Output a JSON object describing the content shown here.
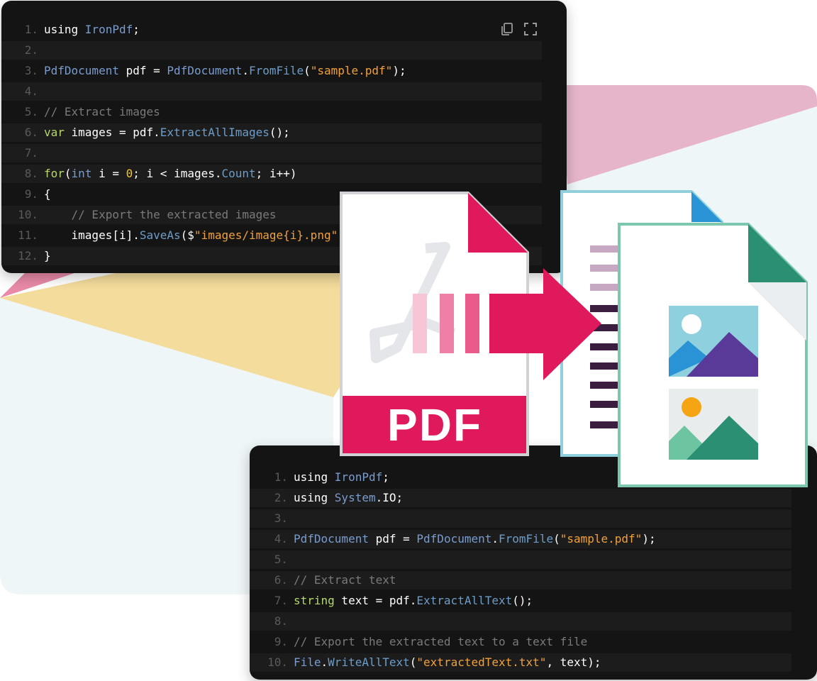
{
  "colors": {
    "panel_bg": "#141414",
    "pdf_accent": "#e0185c",
    "text_doc_accent": "#2a93d5",
    "image_doc_accent": "#2a8f73",
    "bg_pink": "#e7b8cc",
    "bg_yellow": "#f4dfa0",
    "bg_light": "#eef6f8"
  },
  "top_code": {
    "toolbar": {
      "copy_icon": "copy-icon",
      "fullscreen_icon": "fullscreen-icon"
    },
    "lines": [
      {
        "num": "1.",
        "tokens": [
          {
            "t": "using ",
            "c": "t-plain"
          },
          {
            "t": "IronPdf",
            "c": "t-type"
          },
          {
            "t": ";",
            "c": "t-plain"
          }
        ]
      },
      {
        "num": "2.",
        "tokens": []
      },
      {
        "num": "3.",
        "tokens": [
          {
            "t": "PdfDocument",
            "c": "t-type"
          },
          {
            "t": " pdf = ",
            "c": "t-plain"
          },
          {
            "t": "PdfDocument",
            "c": "t-type"
          },
          {
            "t": ".",
            "c": "t-plain"
          },
          {
            "t": "FromFile",
            "c": "t-method"
          },
          {
            "t": "(",
            "c": "t-plain"
          },
          {
            "t": "\"sample.pdf\"",
            "c": "t-str"
          },
          {
            "t": ");",
            "c": "t-plain"
          }
        ]
      },
      {
        "num": "4.",
        "tokens": []
      },
      {
        "num": "5.",
        "tokens": [
          {
            "t": "// Extract images",
            "c": "t-comment"
          }
        ]
      },
      {
        "num": "6.",
        "tokens": [
          {
            "t": "var",
            "c": "t-kw"
          },
          {
            "t": " images = pdf.",
            "c": "t-plain"
          },
          {
            "t": "ExtractAllImages",
            "c": "t-method"
          },
          {
            "t": "();",
            "c": "t-plain"
          }
        ]
      },
      {
        "num": "7.",
        "tokens": []
      },
      {
        "num": "8.",
        "tokens": [
          {
            "t": "for",
            "c": "t-kw"
          },
          {
            "t": "(",
            "c": "t-plain"
          },
          {
            "t": "int",
            "c": "t-type"
          },
          {
            "t": " i = ",
            "c": "t-plain"
          },
          {
            "t": "0",
            "c": "t-num"
          },
          {
            "t": "; i < images.",
            "c": "t-plain"
          },
          {
            "t": "Count",
            "c": "t-method"
          },
          {
            "t": "; i++)",
            "c": "t-plain"
          }
        ]
      },
      {
        "num": "9.",
        "tokens": [
          {
            "t": "{",
            "c": "t-plain"
          }
        ]
      },
      {
        "num": "10.",
        "tokens": [
          {
            "t": "    // Export the extracted images",
            "c": "t-comment"
          }
        ]
      },
      {
        "num": "11.",
        "tokens": [
          {
            "t": "    images[i].",
            "c": "t-plain"
          },
          {
            "t": "SaveAs",
            "c": "t-method"
          },
          {
            "t": "($",
            "c": "t-plain"
          },
          {
            "t": "\"images/image{i}.png\"",
            "c": "t-str"
          },
          {
            "t": ");",
            "c": "t-plain"
          }
        ]
      },
      {
        "num": "12.",
        "tokens": [
          {
            "t": "}",
            "c": "t-plain"
          }
        ]
      }
    ]
  },
  "bottom_code": {
    "lines": [
      {
        "num": "1.",
        "tokens": [
          {
            "t": "using ",
            "c": "t-plain"
          },
          {
            "t": "IronPdf",
            "c": "t-type"
          },
          {
            "t": ";",
            "c": "t-plain"
          }
        ]
      },
      {
        "num": "2.",
        "tokens": [
          {
            "t": "using ",
            "c": "t-plain"
          },
          {
            "t": "System",
            "c": "t-type"
          },
          {
            "t": ".IO;",
            "c": "t-plain"
          }
        ]
      },
      {
        "num": "3.",
        "tokens": []
      },
      {
        "num": "4.",
        "tokens": [
          {
            "t": "PdfDocument",
            "c": "t-type"
          },
          {
            "t": " pdf = ",
            "c": "t-plain"
          },
          {
            "t": "PdfDocument",
            "c": "t-type"
          },
          {
            "t": ".",
            "c": "t-plain"
          },
          {
            "t": "FromFile",
            "c": "t-method"
          },
          {
            "t": "(",
            "c": "t-plain"
          },
          {
            "t": "\"sample.pdf\"",
            "c": "t-str"
          },
          {
            "t": ");",
            "c": "t-plain"
          }
        ]
      },
      {
        "num": "5.",
        "tokens": []
      },
      {
        "num": "6.",
        "tokens": [
          {
            "t": "// Extract text",
            "c": "t-comment"
          }
        ]
      },
      {
        "num": "7.",
        "tokens": [
          {
            "t": "string",
            "c": "t-kw"
          },
          {
            "t": " text = pdf.",
            "c": "t-plain"
          },
          {
            "t": "ExtractAllText",
            "c": "t-method"
          },
          {
            "t": "();",
            "c": "t-plain"
          }
        ]
      },
      {
        "num": "8.",
        "tokens": []
      },
      {
        "num": "9.",
        "tokens": [
          {
            "t": "// Export the extracted text to a text file",
            "c": "t-comment"
          }
        ]
      },
      {
        "num": "10.",
        "tokens": [
          {
            "t": "File",
            "c": "t-type"
          },
          {
            "t": ".",
            "c": "t-plain"
          },
          {
            "t": "WriteAllText",
            "c": "t-method"
          },
          {
            "t": "(",
            "c": "t-plain"
          },
          {
            "t": "\"extractedText.txt\"",
            "c": "t-str"
          },
          {
            "t": ", text);",
            "c": "t-plain"
          }
        ]
      }
    ]
  },
  "illustration": {
    "pdf_label": "PDF",
    "pdf_icon": "acrobat-icon",
    "arrow_icon": "arrow-right-icon",
    "text_doc_icon": "text-document-icon",
    "image_doc_icon": "image-document-icon",
    "picture_icons": [
      "landscape-icon",
      "landscape-icon"
    ]
  }
}
